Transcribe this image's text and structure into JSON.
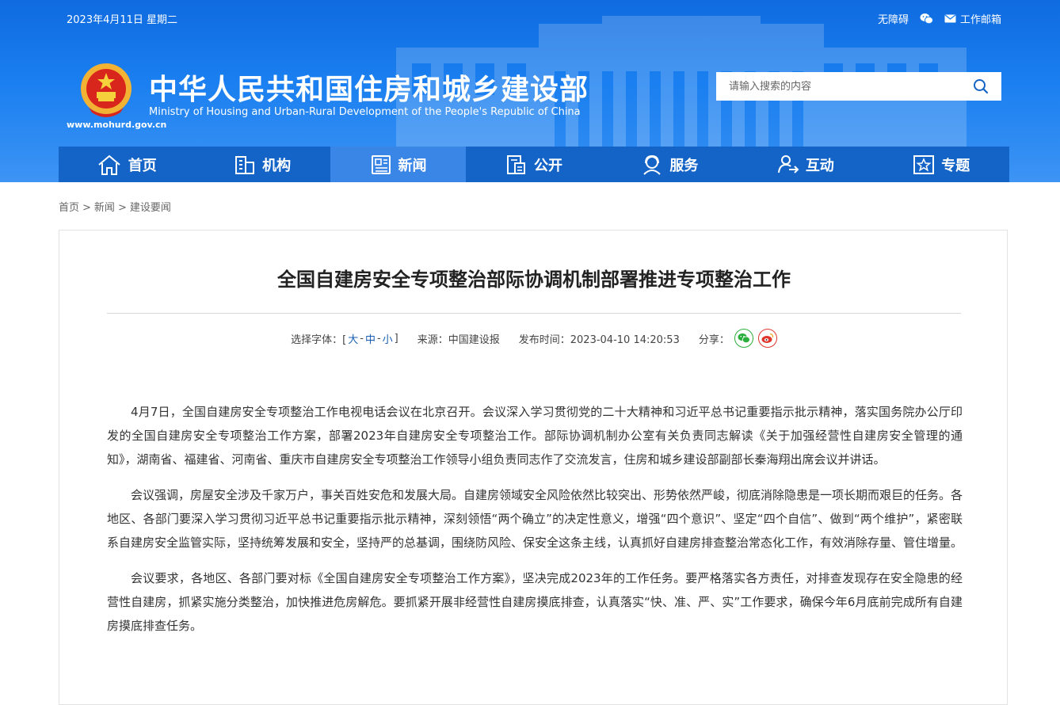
{
  "header": {
    "date": "2023年4月11日 星期二",
    "links": {
      "accessibility": "无障碍",
      "mail": "工作邮箱"
    },
    "site_domain": "www.mohurd.gov.cn",
    "title_cn": "中华人民共和国住房和城乡建设部",
    "title_en": "Ministry of Housing and Urban-Rural Development of the People's Republic of China",
    "search_placeholder": "请输入搜索的内容"
  },
  "nav": [
    {
      "label": "首页",
      "icon": "home-icon"
    },
    {
      "label": "机构",
      "icon": "building-icon"
    },
    {
      "label": "新闻",
      "icon": "news-icon",
      "active": true
    },
    {
      "label": "公开",
      "icon": "document-icon"
    },
    {
      "label": "服务",
      "icon": "service-icon"
    },
    {
      "label": "互动",
      "icon": "interaction-icon"
    },
    {
      "label": "专题",
      "icon": "star-icon"
    }
  ],
  "breadcrumb": {
    "home": "首页",
    "news": "新闻",
    "current": "建设要闻",
    "sep": ">"
  },
  "article": {
    "title": "全国自建房安全专项整治部际协调机制部署推进专项整治工作",
    "meta": {
      "font_label": "选择字体：[",
      "font_large": "大",
      "font_medium": "中",
      "font_small": "小",
      "dash": "-",
      "font_close": "]",
      "source": "来源：中国建设报",
      "published": "发布时间：2023-04-10 14:20:53",
      "share_label": "分享："
    },
    "paragraphs": [
      "4月7日，全国自建房安全专项整治工作电视电话会议在北京召开。会议深入学习贯彻党的二十大精神和习近平总书记重要指示批示精神，落实国务院办公厅印发的全国自建房安全专项整治工作方案，部署2023年自建房安全专项整治工作。部际协调机制办公室有关负责同志解读《关于加强经营性自建房安全管理的通知》，湖南省、福建省、河南省、重庆市自建房安全专项整治工作领导小组负责同志作了交流发言，住房和城乡建设部副部长秦海翔出席会议并讲话。",
      "会议强调，房屋安全涉及千家万户，事关百姓安危和发展大局。自建房领域安全风险依然比较突出、形势依然严峻，彻底消除隐患是一项长期而艰巨的任务。各地区、各部门要深入学习贯彻习近平总书记重要指示批示精神，深刻领悟“两个确立”的决定性意义，增强“四个意识”、坚定“四个自信”、做到“两个维护”，紧密联系自建房安全监管实际，坚持统筹发展和安全，坚持严的总基调，围绕防风险、保安全这条主线，认真抓好自建房排查整治常态化工作，有效消除存量、管住增量。",
      "会议要求，各地区、各部门要对标《全国自建房安全专项整治工作方案》，坚决完成2023年的工作任务。要严格落实各方责任，对排查发现存在安全隐患的经营性自建房，抓紧实施分类整治，加快推进危房解危。要抓紧开展非经营性自建房摸底排查，认真落实“快、准、严、实”工作要求，确保今年6月底前完成所有自建房摸底排查任务。"
    ]
  },
  "colors": {
    "header_blue": "#1a7ff0",
    "nav_blue": "#1464c8",
    "nav_active": "#3a86e6",
    "link_blue": "#1a5fb4",
    "wechat_green": "#2aae3c",
    "weibo_red": "#e0352b"
  }
}
